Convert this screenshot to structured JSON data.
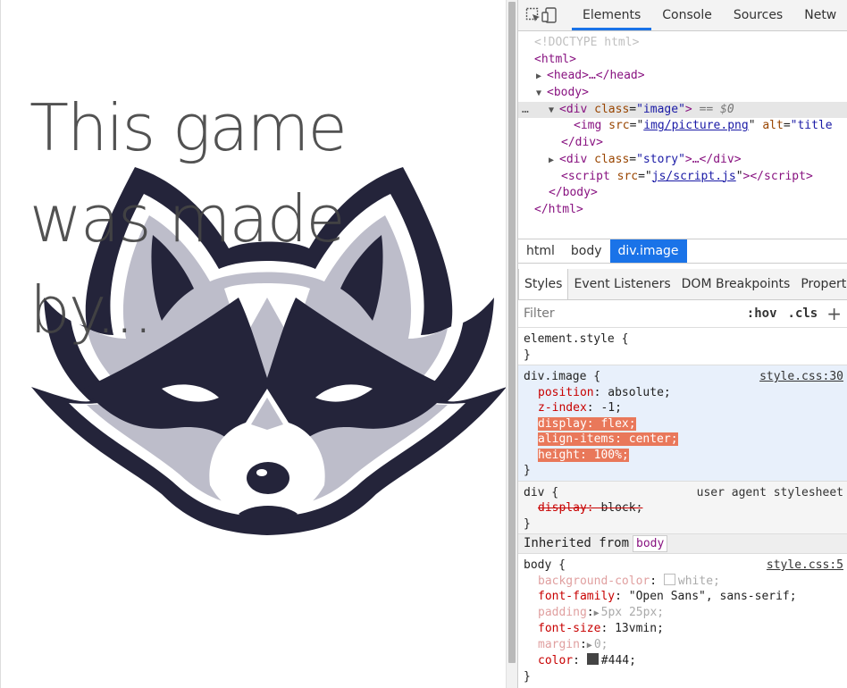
{
  "page": {
    "headline": "This game was made by..."
  },
  "devtools": {
    "tabs": [
      "Elements",
      "Console",
      "Sources",
      "Netw"
    ],
    "active_tab": "Elements",
    "dom": {
      "doctype": "<!DOCTYPE html>",
      "html_open": "<html>",
      "head": "<head>…</head>",
      "body_open": "<body>",
      "div_image_tag": "div",
      "div_image_attr": "class",
      "div_image_val": "\"image\"",
      "selected_marker": "== $0",
      "img_attr_src": "src",
      "img_src": "img/picture.png",
      "img_attr_alt": "alt",
      "img_alt": "\"title",
      "div_close": "</div>",
      "div_story_val": "\"story\"",
      "div_story_rest": ">…</div>",
      "script_src": "js/script.js",
      "body_close": "</body>",
      "html_close": "</html>"
    },
    "breadcrumb": [
      "html",
      "body",
      "div.image"
    ],
    "subtabs": [
      "Styles",
      "Event Listeners",
      "DOM Breakpoints",
      "Propert"
    ],
    "filter": {
      "placeholder": "Filter",
      "hov": ":hov",
      "cls": ".cls",
      "plus": "+"
    },
    "styles": {
      "element_style": "element.style {",
      "close_brace": "}",
      "div_image": {
        "selector": "div.image {",
        "source": "style.css:30",
        "decls": [
          {
            "prop": "position",
            "value": "absolute;"
          },
          {
            "prop": "z-index",
            "value": "-1;"
          },
          {
            "prop": "display",
            "value": "flex;"
          },
          {
            "prop": "align-items",
            "value": "center;"
          },
          {
            "prop": "height",
            "value": "100%;"
          }
        ]
      },
      "div_ua": {
        "selector": "div {",
        "source": "user agent stylesheet",
        "prop": "display",
        "value": "block;"
      },
      "inherited_label": "Inherited from",
      "inherited_tag": "body",
      "body_rule": {
        "selector": "body {",
        "source": "style.css:5",
        "decls": [
          {
            "prop": "background-color",
            "value": "white;"
          },
          {
            "prop": "font-family",
            "value": "\"Open Sans\", sans-serif;"
          },
          {
            "prop": "padding",
            "value": "5px 25px;"
          },
          {
            "prop": "font-size",
            "value": "13vmin;"
          },
          {
            "prop": "margin",
            "value": "0;"
          },
          {
            "prop": "color",
            "value": "#444;"
          }
        ]
      }
    }
  },
  "colors": {
    "raccoon_dark": "#24243a",
    "raccoon_gray": "#bdbdca",
    "accent": "#1a73e8",
    "highlight": "#e9785a",
    "text": "#444444"
  },
  "icons": [
    "inspect-element-icon",
    "device-toolbar-icon",
    "expand-triangle-icon",
    "collapse-triangle-icon",
    "new-style-rule-icon",
    "raccoon-logo"
  ]
}
